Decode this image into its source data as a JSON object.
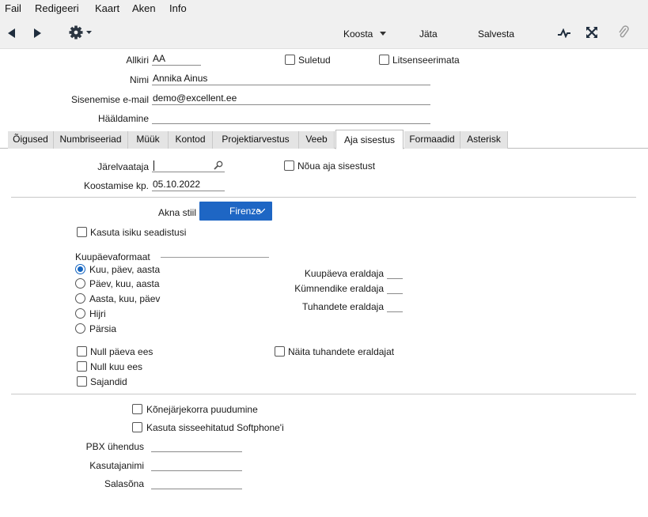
{
  "menubar": {
    "items": [
      "Fail",
      "Redigeeri",
      "Kaart",
      "Aken",
      "Info"
    ]
  },
  "toolbar": {
    "koosta": "Koosta",
    "jata": "Jäta",
    "salvesta": "Salvesta"
  },
  "header": {
    "allkiri_label": "Allkiri",
    "allkiri_value": "AA",
    "suletud_label": "Suletud",
    "litsenseerimata_label": "Litsenseerimata",
    "nimi_label": "Nimi",
    "nimi_value": "Annika Ainus",
    "email_label": "Sisenemise e-mail",
    "email_value": "demo@excellent.ee",
    "haaldamine_label": "Hääldamine",
    "haaldamine_value": ""
  },
  "tabs": [
    "Õigused",
    "Numbriseeriad",
    "Müük",
    "Kontod",
    "Projektiarvestus",
    "Veeb",
    "Aja sisestus",
    "Formaadid",
    "Asterisk"
  ],
  "active_tab": "Aja sisestus",
  "time_entry": {
    "jarelvaataja_label": "Järelvaataja",
    "jarelvaataja_value": "",
    "noua_label": "Nõua aja sisestust",
    "koostamise_label": "Koostamise kp.",
    "koostamise_value": "05.10.2022"
  },
  "style": {
    "akna_stil_label": "Akna stiil",
    "akna_stil_value": "Firenze",
    "kasuta_isiku_label": "Kasuta isiku seadistusi"
  },
  "date_format": {
    "label": "Kuupäevaformaat",
    "options": [
      "Kuu, päev, aasta",
      "Päev, kuu, aasta",
      "Aasta, kuu, päev",
      "Hijri",
      "Pärsia"
    ],
    "selected_index": 0,
    "kuupaeva_eraldaja_label": "Kuupäeva eraldaja",
    "kymnendike_eraldaja_label": "Kümnendike eraldaja",
    "tuhandete_eraldaja_label": "Tuhandete eraldaja",
    "null_paeva_label": "Null päeva ees",
    "null_kuu_label": "Null kuu ees",
    "sajandid_label": "Sajandid",
    "naita_tuhandete_label": "Näita tuhandete eraldajat"
  },
  "phone": {
    "konejarjekorra_label": "Kõnejärjekorra puudumine",
    "softphone_label": "Kasuta sisseehitatud Softphone'i",
    "pbx_label": "PBX ühendus",
    "kasutajanimi_label": "Kasutajanimi",
    "salasona_label": "Salasõna"
  },
  "colors": {
    "accent": "#1e66c4",
    "toolbar_bg": "#f0f0f0",
    "tab_inactive_bg": "#e4e4e4"
  }
}
